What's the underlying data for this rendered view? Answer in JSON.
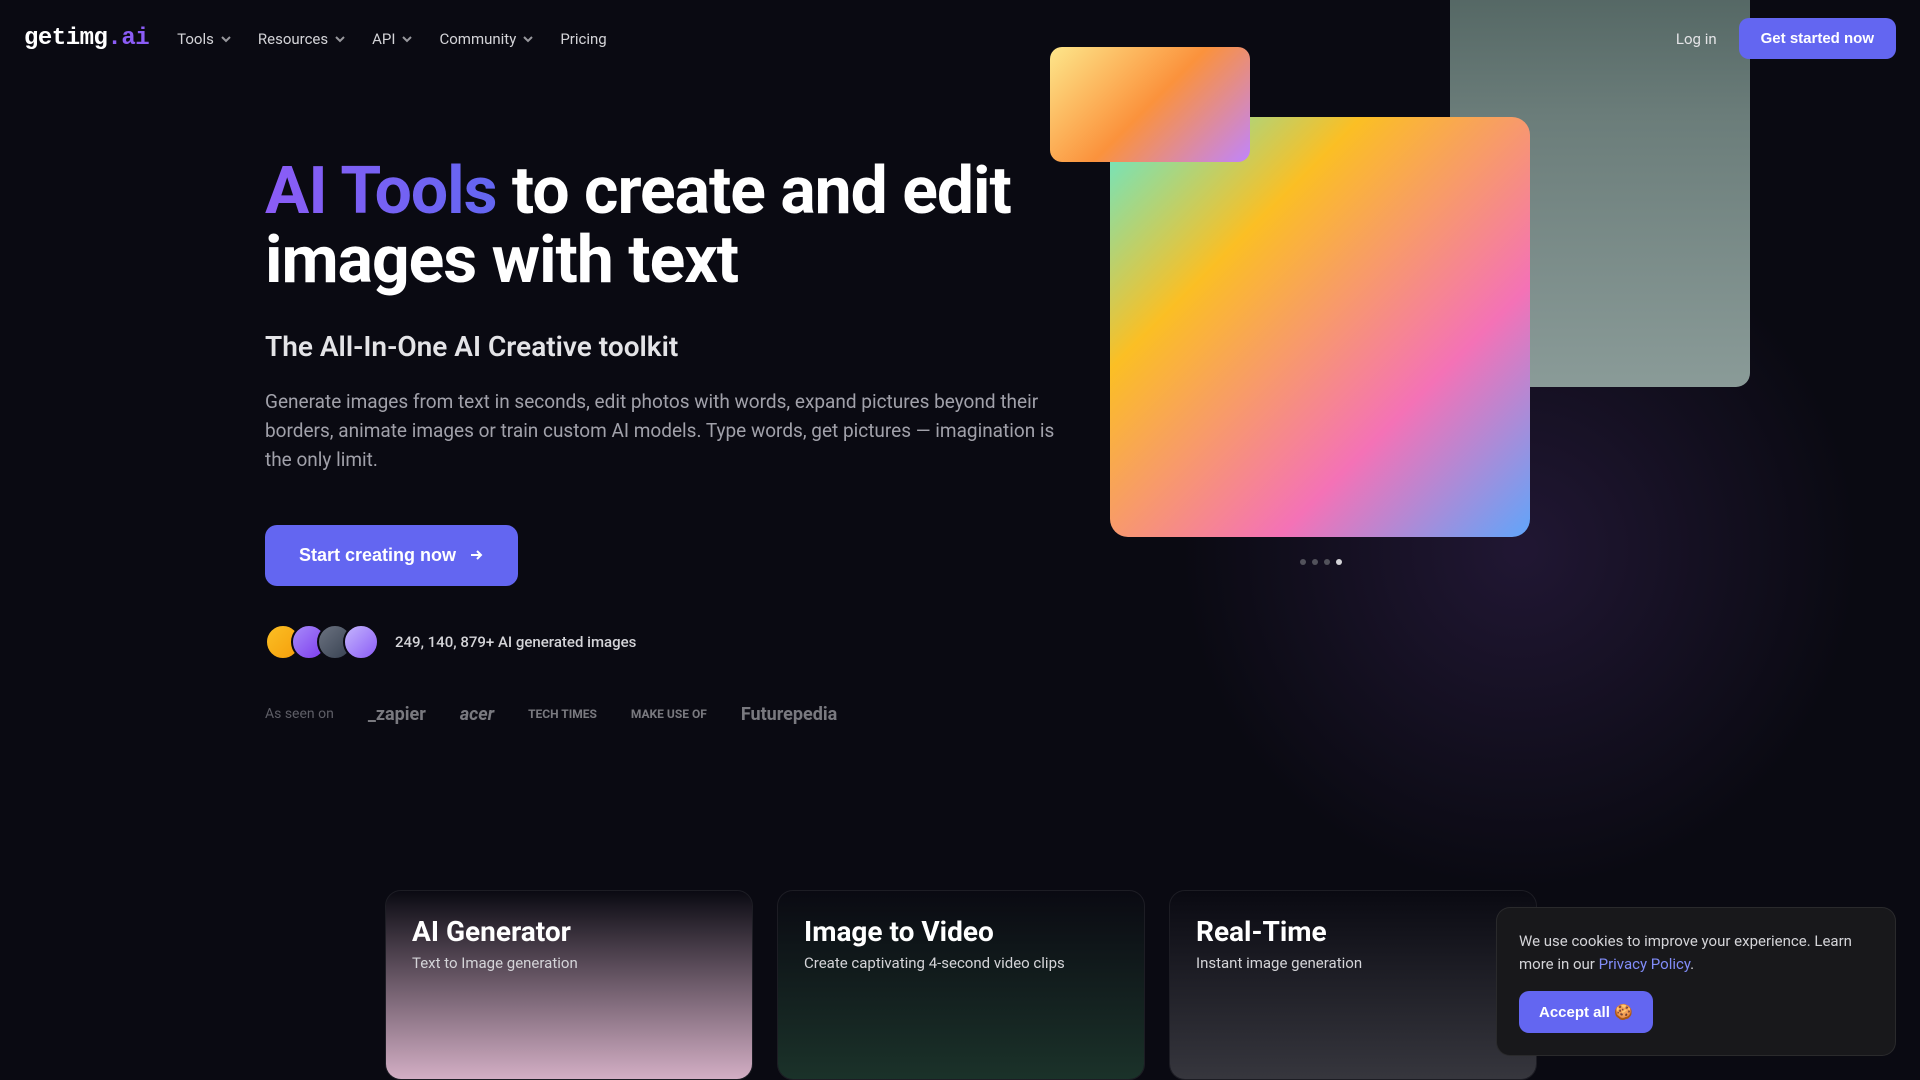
{
  "brand": {
    "name": "getimg",
    "suffix": ".ai"
  },
  "nav": {
    "items": [
      {
        "label": "Tools"
      },
      {
        "label": "Resources"
      },
      {
        "label": "API"
      },
      {
        "label": "Community"
      },
      {
        "label": "Pricing",
        "no_chevron": true
      }
    ],
    "login": "Log in",
    "cta": "Get started now"
  },
  "hero": {
    "title_highlight": "AI Tools",
    "title_rest": " to create and edit images with text",
    "subtitle": "The All-In-One AI Creative toolkit",
    "description": "Generate images from text in seconds, edit photos with words, expand pictures beyond their borders, animate images or train custom AI models. Type words, get pictures — imagination is the only limit.",
    "cta": "Start creating now",
    "proof": "249, 140, 879+ AI generated images"
  },
  "seen": {
    "label": "As seen on",
    "logos": [
      "_zapier",
      "acer",
      "TECH TIMES",
      "MAKE USE OF",
      "Futurepedia"
    ]
  },
  "cards": [
    {
      "title": "AI Generator",
      "sub": "Text to Image generation"
    },
    {
      "title": "Image to Video",
      "sub": "Create captivating 4-second video clips"
    },
    {
      "title": "Real-Time",
      "sub": "Instant image generation"
    }
  ],
  "cookie": {
    "text_pre": "We use cookies to improve your experience. Learn more in our ",
    "link": "Privacy Policy",
    "text_post": ".",
    "button": "Accept all 🍪"
  }
}
